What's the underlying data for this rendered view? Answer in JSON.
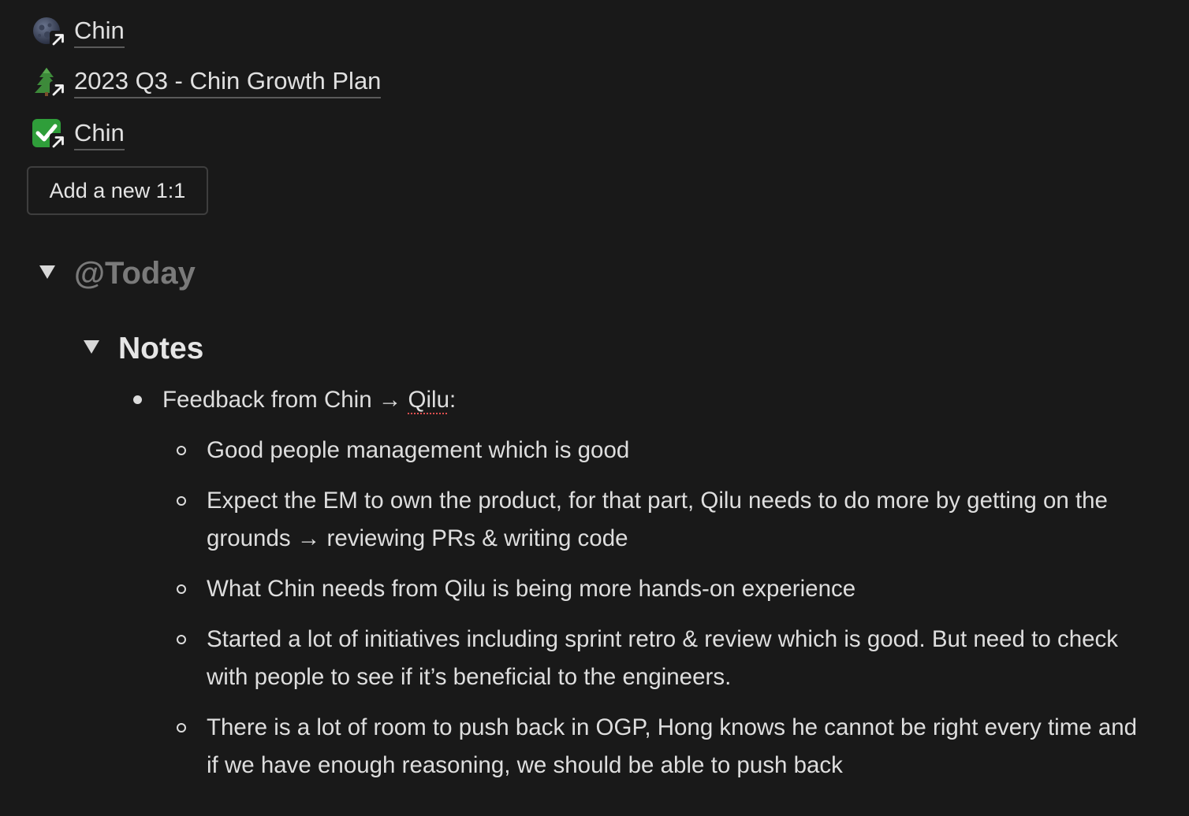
{
  "links": [
    {
      "icon": "moon-icon",
      "label": "Chin"
    },
    {
      "icon": "tree-icon",
      "label": "2023 Q3 - Chin Growth Plan"
    },
    {
      "icon": "checkmark-icon",
      "label": "Chin"
    }
  ],
  "add_button_label": "Add a new 1:1",
  "today_heading": "@Today",
  "notes_heading": "Notes",
  "feedback": {
    "prefix": "Feedback from Chin → ",
    "name": "Qilu",
    "suffix": ":"
  },
  "sub_items": [
    "Good people management which is good",
    "Expect the EM to own the product, for that part, Qilu needs to do more by getting on the grounds → reviewing PRs & writing code",
    "What Chin needs from Qilu is being more hands-on experience",
    "Started a lot of initiatives including sprint retro & review which is good. But need to check with people to see if it’s beneficial to the engineers.",
    "There is a lot of room to push back in OGP, Hong knows he cannot be right every time and if we have enough reasoning, we should be able to push back"
  ],
  "colors": {
    "background": "#191919",
    "text": "#dedede",
    "muted_heading": "#7a7a7a",
    "check_green": "#2f9e3a",
    "spellcheck": "#e05050"
  }
}
